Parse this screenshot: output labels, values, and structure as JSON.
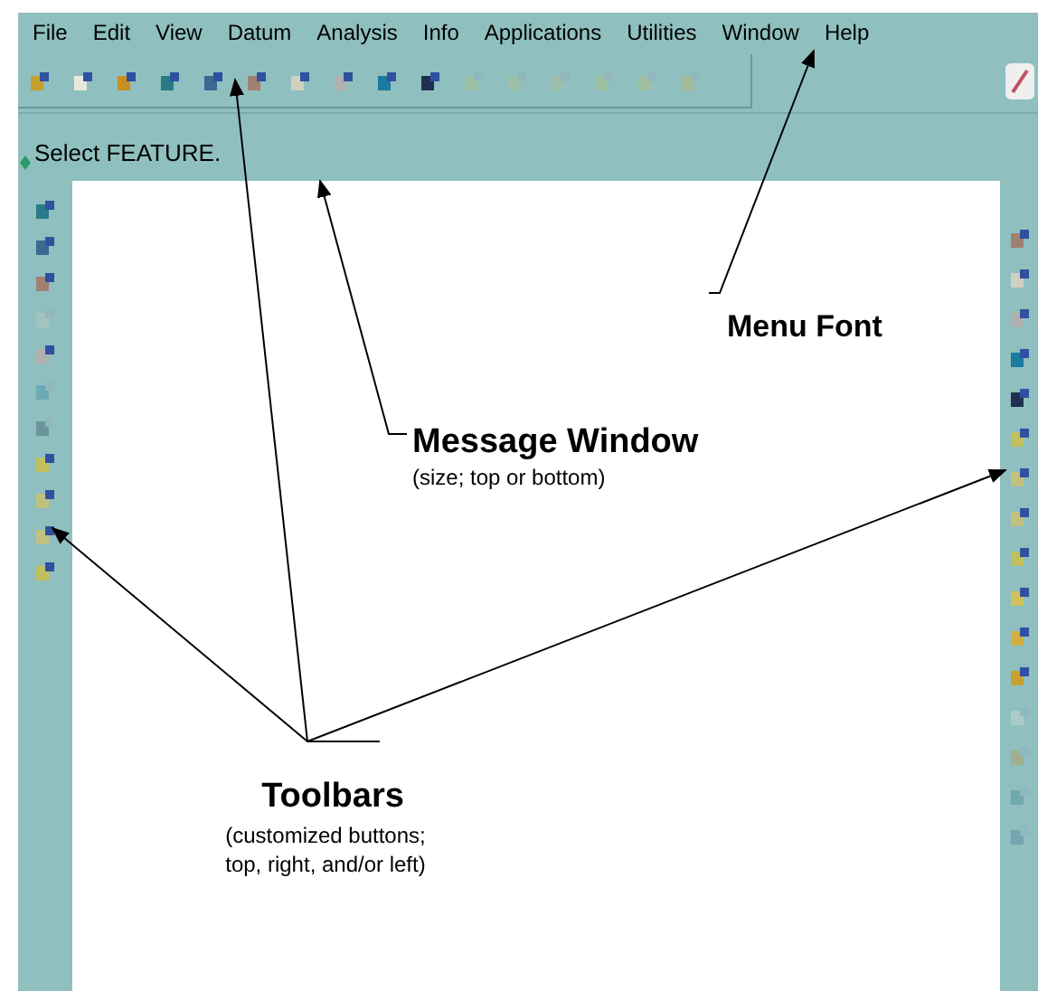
{
  "menu": [
    "File",
    "Edit",
    "View",
    "Datum",
    "Analysis",
    "Info",
    "Applications",
    "Utilities",
    "Window",
    "Help"
  ],
  "top_toolbar": [
    {
      "disabled": false
    },
    {
      "disabled": false
    },
    {
      "disabled": false
    },
    {
      "disabled": false
    },
    {
      "disabled": false
    },
    {
      "disabled": false
    },
    {
      "disabled": false
    },
    {
      "disabled": false
    },
    {
      "disabled": false
    },
    {
      "disabled": false
    },
    {
      "disabled": true
    },
    {
      "disabled": true
    },
    {
      "disabled": true
    },
    {
      "disabled": true
    },
    {
      "disabled": true
    },
    {
      "disabled": true
    }
  ],
  "message": "Select FEATURE.",
  "left_toolbar": [
    {
      "disabled": false
    },
    {
      "disabled": false
    },
    {
      "disabled": false
    },
    {
      "disabled": true
    },
    {
      "disabled": false
    },
    {
      "disabled": true
    },
    {
      "disabled": true
    },
    {
      "disabled": false
    },
    {
      "disabled": false
    },
    {
      "disabled": false
    },
    {
      "disabled": false
    }
  ],
  "right_toolbar": [
    {
      "disabled": false
    },
    {
      "disabled": false
    },
    {
      "disabled": false
    },
    {
      "disabled": false
    },
    {
      "disabled": false
    },
    {
      "disabled": false
    },
    {
      "disabled": false
    },
    {
      "disabled": false
    },
    {
      "disabled": false
    },
    {
      "disabled": false
    },
    {
      "disabled": false
    },
    {
      "disabled": false
    },
    {
      "disabled": true
    },
    {
      "disabled": true
    },
    {
      "disabled": true
    },
    {
      "disabled": true
    }
  ],
  "annotations": [
    {
      "title": "Menu Font"
    },
    {
      "title": "Message Window",
      "lines": [
        "(size; top or bottom)"
      ]
    },
    {
      "title": "Toolbars",
      "lines": [
        "(customized buttons;",
        "top, right, and/or left)"
      ]
    }
  ]
}
